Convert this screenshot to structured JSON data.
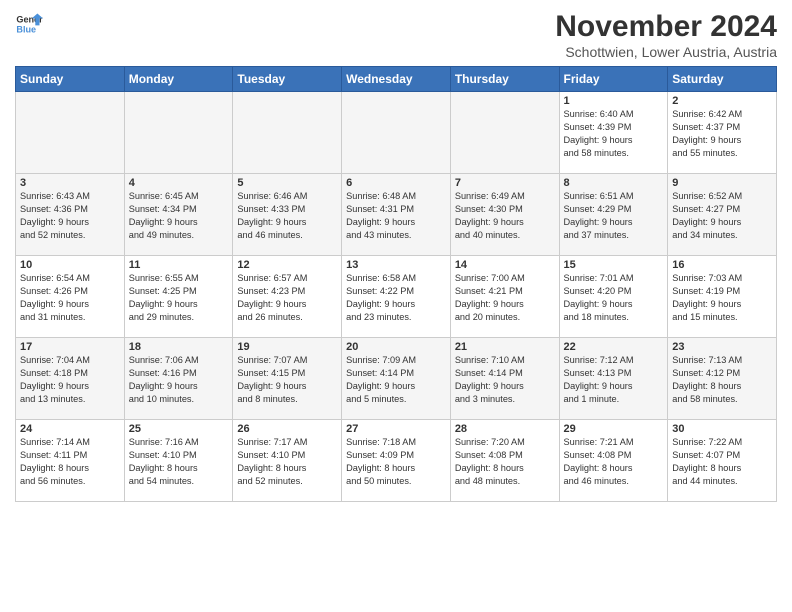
{
  "logo": {
    "line1": "General",
    "line2": "Blue"
  },
  "title": "November 2024",
  "subtitle": "Schottwien, Lower Austria, Austria",
  "weekdays": [
    "Sunday",
    "Monday",
    "Tuesday",
    "Wednesday",
    "Thursday",
    "Friday",
    "Saturday"
  ],
  "weeks": [
    [
      {
        "day": "",
        "info": ""
      },
      {
        "day": "",
        "info": ""
      },
      {
        "day": "",
        "info": ""
      },
      {
        "day": "",
        "info": ""
      },
      {
        "day": "",
        "info": ""
      },
      {
        "day": "1",
        "info": "Sunrise: 6:40 AM\nSunset: 4:39 PM\nDaylight: 9 hours\nand 58 minutes."
      },
      {
        "day": "2",
        "info": "Sunrise: 6:42 AM\nSunset: 4:37 PM\nDaylight: 9 hours\nand 55 minutes."
      }
    ],
    [
      {
        "day": "3",
        "info": "Sunrise: 6:43 AM\nSunset: 4:36 PM\nDaylight: 9 hours\nand 52 minutes."
      },
      {
        "day": "4",
        "info": "Sunrise: 6:45 AM\nSunset: 4:34 PM\nDaylight: 9 hours\nand 49 minutes."
      },
      {
        "day": "5",
        "info": "Sunrise: 6:46 AM\nSunset: 4:33 PM\nDaylight: 9 hours\nand 46 minutes."
      },
      {
        "day": "6",
        "info": "Sunrise: 6:48 AM\nSunset: 4:31 PM\nDaylight: 9 hours\nand 43 minutes."
      },
      {
        "day": "7",
        "info": "Sunrise: 6:49 AM\nSunset: 4:30 PM\nDaylight: 9 hours\nand 40 minutes."
      },
      {
        "day": "8",
        "info": "Sunrise: 6:51 AM\nSunset: 4:29 PM\nDaylight: 9 hours\nand 37 minutes."
      },
      {
        "day": "9",
        "info": "Sunrise: 6:52 AM\nSunset: 4:27 PM\nDaylight: 9 hours\nand 34 minutes."
      }
    ],
    [
      {
        "day": "10",
        "info": "Sunrise: 6:54 AM\nSunset: 4:26 PM\nDaylight: 9 hours\nand 31 minutes."
      },
      {
        "day": "11",
        "info": "Sunrise: 6:55 AM\nSunset: 4:25 PM\nDaylight: 9 hours\nand 29 minutes."
      },
      {
        "day": "12",
        "info": "Sunrise: 6:57 AM\nSunset: 4:23 PM\nDaylight: 9 hours\nand 26 minutes."
      },
      {
        "day": "13",
        "info": "Sunrise: 6:58 AM\nSunset: 4:22 PM\nDaylight: 9 hours\nand 23 minutes."
      },
      {
        "day": "14",
        "info": "Sunrise: 7:00 AM\nSunset: 4:21 PM\nDaylight: 9 hours\nand 20 minutes."
      },
      {
        "day": "15",
        "info": "Sunrise: 7:01 AM\nSunset: 4:20 PM\nDaylight: 9 hours\nand 18 minutes."
      },
      {
        "day": "16",
        "info": "Sunrise: 7:03 AM\nSunset: 4:19 PM\nDaylight: 9 hours\nand 15 minutes."
      }
    ],
    [
      {
        "day": "17",
        "info": "Sunrise: 7:04 AM\nSunset: 4:18 PM\nDaylight: 9 hours\nand 13 minutes."
      },
      {
        "day": "18",
        "info": "Sunrise: 7:06 AM\nSunset: 4:16 PM\nDaylight: 9 hours\nand 10 minutes."
      },
      {
        "day": "19",
        "info": "Sunrise: 7:07 AM\nSunset: 4:15 PM\nDaylight: 9 hours\nand 8 minutes."
      },
      {
        "day": "20",
        "info": "Sunrise: 7:09 AM\nSunset: 4:14 PM\nDaylight: 9 hours\nand 5 minutes."
      },
      {
        "day": "21",
        "info": "Sunrise: 7:10 AM\nSunset: 4:14 PM\nDaylight: 9 hours\nand 3 minutes."
      },
      {
        "day": "22",
        "info": "Sunrise: 7:12 AM\nSunset: 4:13 PM\nDaylight: 9 hours\nand 1 minute."
      },
      {
        "day": "23",
        "info": "Sunrise: 7:13 AM\nSunset: 4:12 PM\nDaylight: 8 hours\nand 58 minutes."
      }
    ],
    [
      {
        "day": "24",
        "info": "Sunrise: 7:14 AM\nSunset: 4:11 PM\nDaylight: 8 hours\nand 56 minutes."
      },
      {
        "day": "25",
        "info": "Sunrise: 7:16 AM\nSunset: 4:10 PM\nDaylight: 8 hours\nand 54 minutes."
      },
      {
        "day": "26",
        "info": "Sunrise: 7:17 AM\nSunset: 4:10 PM\nDaylight: 8 hours\nand 52 minutes."
      },
      {
        "day": "27",
        "info": "Sunrise: 7:18 AM\nSunset: 4:09 PM\nDaylight: 8 hours\nand 50 minutes."
      },
      {
        "day": "28",
        "info": "Sunrise: 7:20 AM\nSunset: 4:08 PM\nDaylight: 8 hours\nand 48 minutes."
      },
      {
        "day": "29",
        "info": "Sunrise: 7:21 AM\nSunset: 4:08 PM\nDaylight: 8 hours\nand 46 minutes."
      },
      {
        "day": "30",
        "info": "Sunrise: 7:22 AM\nSunset: 4:07 PM\nDaylight: 8 hours\nand 44 minutes."
      }
    ]
  ]
}
